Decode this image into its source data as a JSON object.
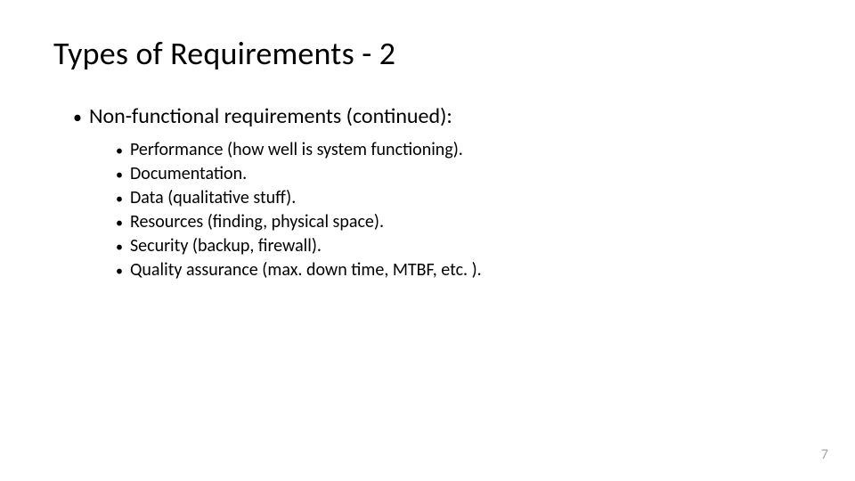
{
  "title": "Types of Requirements - 2",
  "bullet1": "Non-functional requirements (continued):",
  "subbullets": [
    "Performance (how well is system functioning).",
    "Documentation.",
    "Data (qualitative stuff).",
    "Resources (finding, physical space).",
    "Security (backup, firewall).",
    "Quality assurance (max. down time, MTBF, etc. )."
  ],
  "pageNumber": "7"
}
